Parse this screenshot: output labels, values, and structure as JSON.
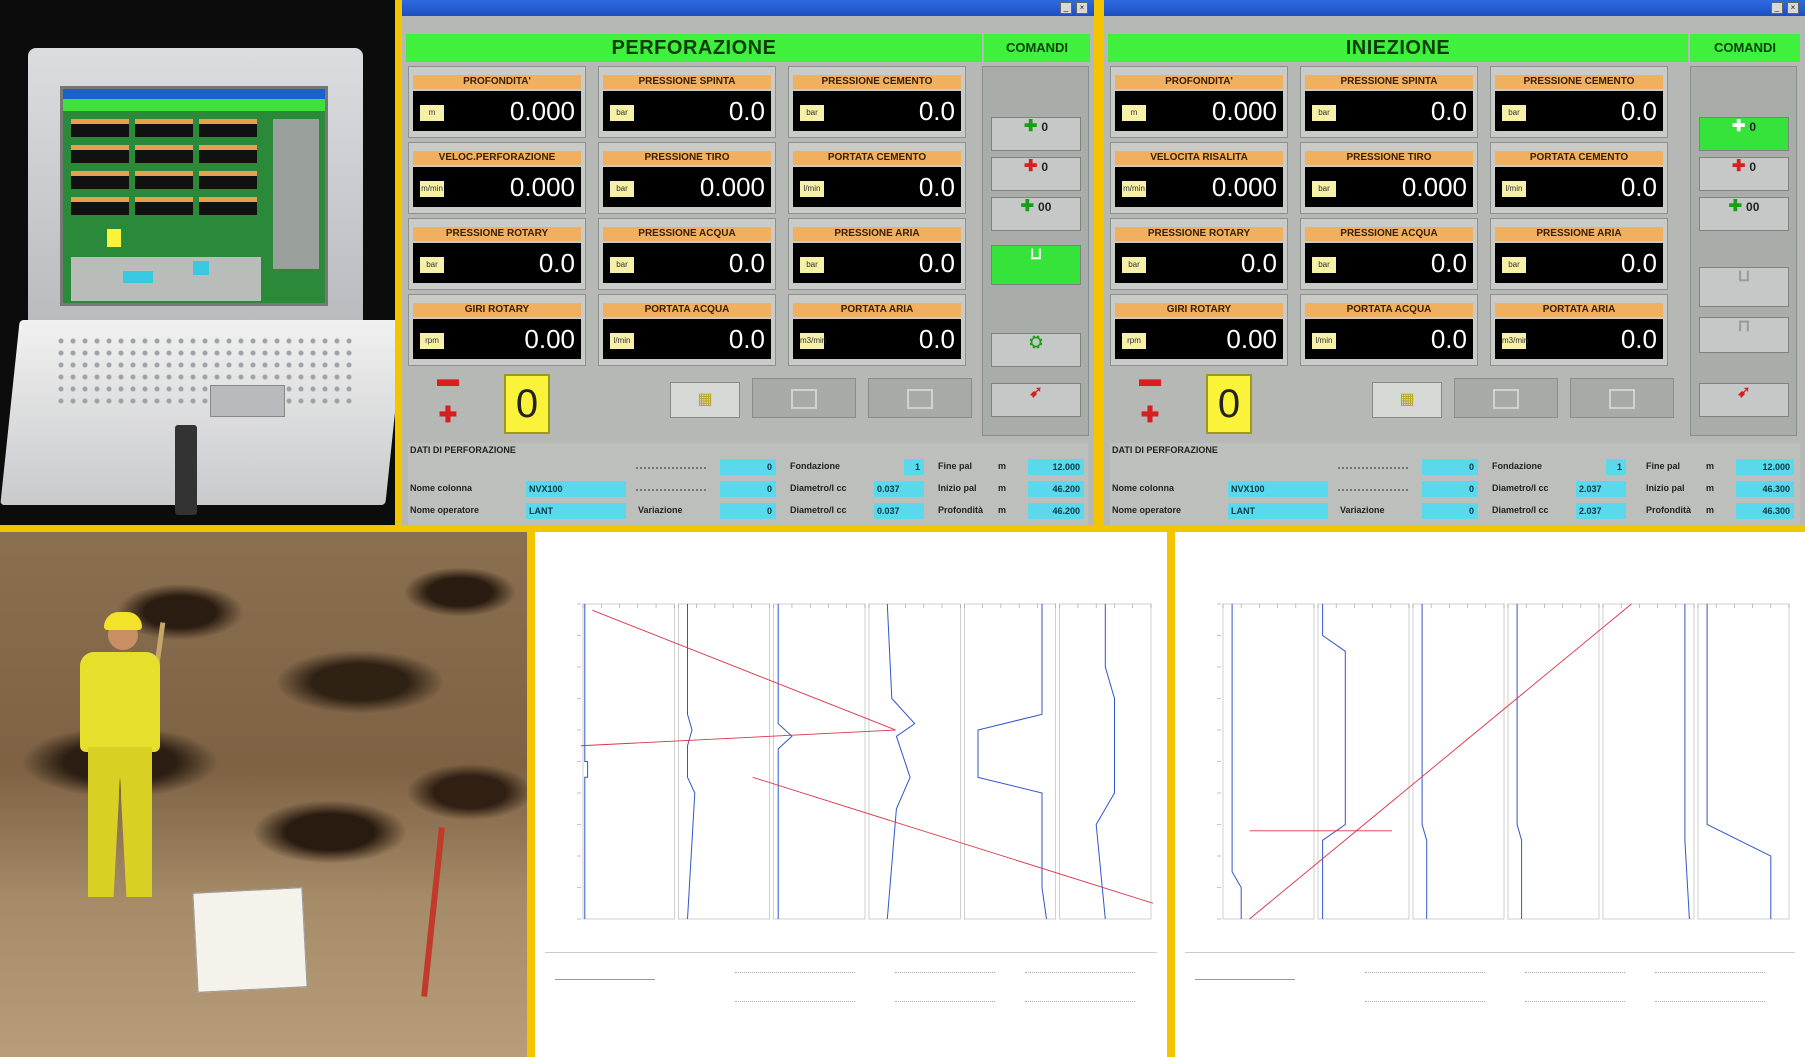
{
  "left_panel": {
    "title": "PERFORAZIONE",
    "commands_title": "COMANDI",
    "gauges": [
      {
        "label": "PROFONDITA'",
        "unit": "m",
        "value": "0.000"
      },
      {
        "label": "PRESSIONE SPINTA",
        "unit": "bar",
        "value": "0.0"
      },
      {
        "label": "PRESSIONE CEMENTO",
        "unit": "bar",
        "value": "0.0"
      },
      {
        "label": "VELOC.PERFORAZIONE",
        "unit": "m/min",
        "value": "0.000"
      },
      {
        "label": "PRESSIONE TIRO",
        "unit": "bar",
        "value": "0.000"
      },
      {
        "label": "PORTATA CEMENTO",
        "unit": "l/min",
        "value": "0.0"
      },
      {
        "label": "PRESSIONE ROTARY",
        "unit": "bar",
        "value": "0.0"
      },
      {
        "label": "PRESSIONE ACQUA",
        "unit": "bar",
        "value": "0.0"
      },
      {
        "label": "PRESSIONE ARIA",
        "unit": "bar",
        "value": "0.0"
      },
      {
        "label": "GIRI ROTARY",
        "unit": "rpm",
        "value": "0.00"
      },
      {
        "label": "PORTATA ACQUA",
        "unit": "l/min",
        "value": "0.0"
      },
      {
        "label": "PORTATA ARIA",
        "unit": "m3/min",
        "value": "0.0"
      }
    ],
    "counter": "0",
    "cmd_buttons": [
      {
        "count": "0"
      },
      {
        "count": "0"
      },
      {
        "count": "00"
      }
    ],
    "data": {
      "title": "DATI DI PERFORAZIONE",
      "nome_colonna_label": "Nome colonna",
      "nome_colonna": "NVX100",
      "nome_operatore_label": "Nome operatore",
      "nome_operatore": "LANT",
      "row1_val": "0",
      "row2_val": "0",
      "fondazione_label": "Fondazione",
      "fondazione": "1",
      "variazione_label": "Variazione",
      "variazione": "0",
      "diametro_label": "Diametro/I cc",
      "diametro1": "0.037",
      "diametro2": "0.037",
      "fine_label": "Fine pal",
      "fine_unit": "m",
      "fine": "12.000",
      "inizio_label": "Inizio pal",
      "inizio_unit": "m",
      "inizio": "46.200",
      "profondita_label": "Profondità",
      "profondita_unit": "m",
      "profondita": "46.200"
    }
  },
  "right_panel": {
    "title": "INIEZIONE",
    "commands_title": "COMANDI",
    "gauges": [
      {
        "label": "PROFONDITA'",
        "unit": "m",
        "value": "0.000"
      },
      {
        "label": "PRESSIONE SPINTA",
        "unit": "bar",
        "value": "0.0"
      },
      {
        "label": "PRESSIONE CEMENTO",
        "unit": "bar",
        "value": "0.0"
      },
      {
        "label": "VELOCITA RISALITA",
        "unit": "m/min",
        "value": "0.000"
      },
      {
        "label": "PRESSIONE TIRO",
        "unit": "bar",
        "value": "0.000"
      },
      {
        "label": "PORTATA CEMENTO",
        "unit": "l/min",
        "value": "0.0"
      },
      {
        "label": "PRESSIONE ROTARY",
        "unit": "bar",
        "value": "0.0"
      },
      {
        "label": "PRESSIONE ACQUA",
        "unit": "bar",
        "value": "0.0"
      },
      {
        "label": "PRESSIONE ARIA",
        "unit": "bar",
        "value": "0.0"
      },
      {
        "label": "GIRI ROTARY",
        "unit": "rpm",
        "value": "0.00"
      },
      {
        "label": "PORTATA ACQUA",
        "unit": "l/min",
        "value": "0.0"
      },
      {
        "label": "PORTATA ARIA",
        "unit": "m3/min",
        "value": "0.0"
      }
    ],
    "counter": "0",
    "cmd_buttons": [
      {
        "count": "0"
      },
      {
        "count": "0"
      },
      {
        "count": "00"
      }
    ],
    "data": {
      "title": "DATI DI PERFORAZIONE",
      "nome_colonna_label": "Nome colonna",
      "nome_colonna": "NVX100",
      "nome_operatore_label": "Nome operatore",
      "nome_operatore": "LANT",
      "row1_val": "0",
      "row2_val": "0",
      "fondazione_label": "Fondazione",
      "fondazione": "1",
      "variazione_label": "Variazione",
      "variazione": "0",
      "diametro_label": "Diametro/I cc",
      "diametro1": "2.037",
      "diametro2": "2.037",
      "fine_label": "Fine pal",
      "fine_unit": "m",
      "fine": "12.000",
      "inizio_label": "Inizio pal",
      "inizio_unit": "m",
      "inizio": "46.300",
      "profondita_label": "Profondità",
      "profondita_unit": "m",
      "profondita": "46.300"
    }
  },
  "colors": {
    "frame": "#f4c400",
    "header_green": "#3ff03c",
    "gauge_label": "#f0b060",
    "data_cyan": "#5ad9ec",
    "counter_yellow": "#fbf23a",
    "trace_blue": "#3355cc",
    "trace_red": "#dd3344"
  },
  "icons": {
    "plus": "plus-icon",
    "minus": "minus-icon",
    "grid": "grid-icon"
  }
}
